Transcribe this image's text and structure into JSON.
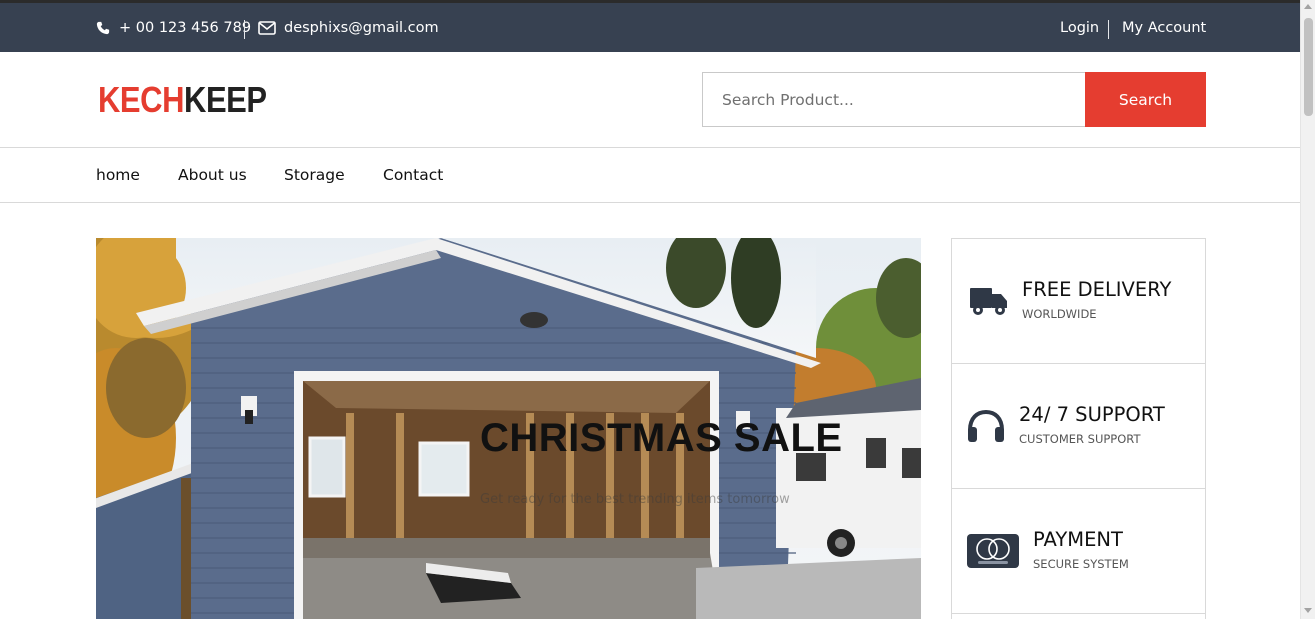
{
  "topbar": {
    "phone": "+ 00 123 456 789",
    "email": "desphixs@gmail.com",
    "login": "Login",
    "account": "My Account",
    "background": "#374151"
  },
  "header": {
    "logo_part1": "KECH",
    "logo_part2": "KEEP",
    "search_placeholder": "Search Product...",
    "search_button": "Search",
    "accent": "#e53d30"
  },
  "nav": {
    "items": [
      {
        "label": "home"
      },
      {
        "label": "About us"
      },
      {
        "label": "Storage"
      },
      {
        "label": "Contact"
      }
    ]
  },
  "hero": {
    "title": "CHRISTMAS SALE",
    "subtitle": "Get ready for the best trending items tomorrow",
    "image": "garage-photo"
  },
  "features": [
    {
      "icon": "truck-icon",
      "title": "FREE DELIVERY",
      "subtitle": "WORLDWIDE"
    },
    {
      "icon": "headphones-icon",
      "title": "24/ 7 SUPPORT",
      "subtitle": "CUSTOMER SUPPORT"
    },
    {
      "icon": "mastercard-icon",
      "title": "PAYMENT",
      "subtitle": "SECURE SYSTEM"
    }
  ]
}
